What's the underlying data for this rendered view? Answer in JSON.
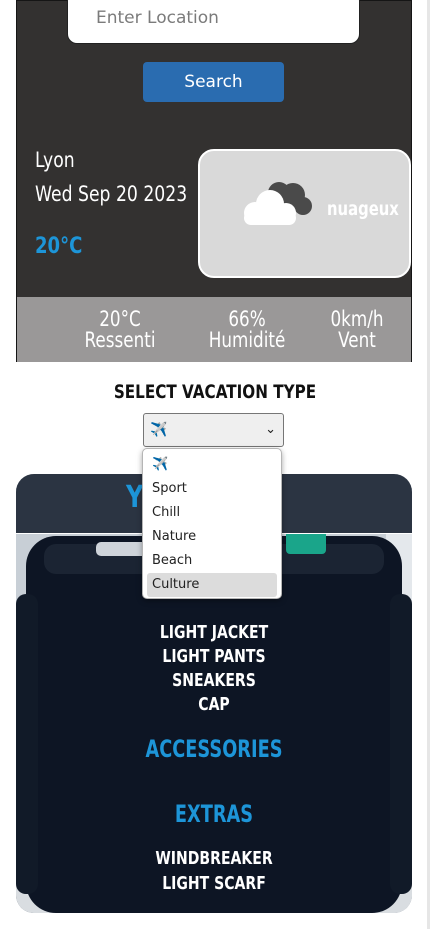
{
  "weather": {
    "location_placeholder": "Enter Location",
    "search_label": "Search",
    "city": "Lyon",
    "date": "Wed Sep 20 2023",
    "temperature": "20°C",
    "condition": "nuageux",
    "feels_like": {
      "value": "20°C",
      "label": "Ressenti"
    },
    "humidity": {
      "value": "66%",
      "label": "Humidité"
    },
    "wind": {
      "value": "0km/h",
      "label": "Vent"
    }
  },
  "vacation": {
    "label": "SELECT VACATION TYPE",
    "selected": "✈️",
    "options": [
      "✈️",
      "Sport",
      "Chill",
      "Nature",
      "Beach",
      "Culture"
    ],
    "highlighted": "Culture"
  },
  "packing": {
    "title_visible": "Y               E:",
    "clothes": [
      "LIGHT JACKET",
      "LIGHT PANTS",
      "SNEAKERS",
      "CAP"
    ],
    "accessories_heading": "ACCESSORIES",
    "extras_heading": "EXTRAS",
    "extras": [
      "WINDBREAKER",
      "LIGHT SCARF"
    ]
  },
  "colors": {
    "accent": "#1d95d8",
    "button": "#2a6cb0",
    "card_bg": "#333130",
    "stats_bg": "#9a9898",
    "condition_bg": "#d9d9d9"
  },
  "icons": {
    "condition_icon": "cloud-icon",
    "select_icon": "airplane-icon"
  }
}
